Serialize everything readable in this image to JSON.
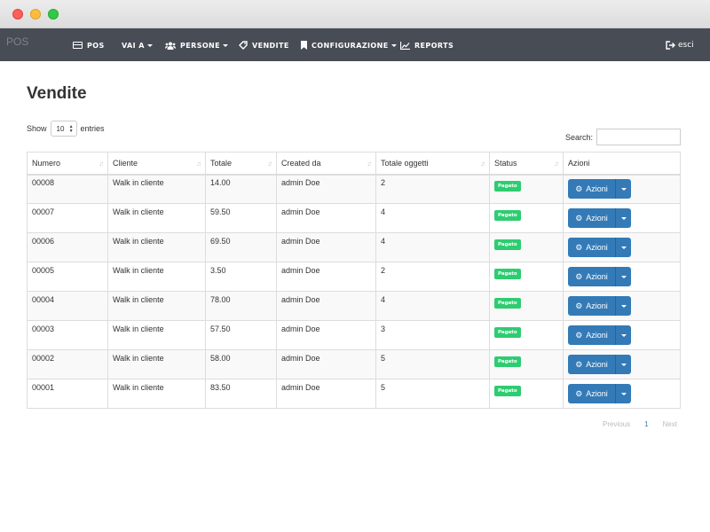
{
  "nav": {
    "brand": "POS",
    "items": [
      {
        "label": "POS",
        "icon": "credit-card-icon"
      },
      {
        "label": "VAI A",
        "icon": "",
        "caret": true
      },
      {
        "label": "PERSONE",
        "icon": "users-icon",
        "caret": true
      },
      {
        "label": "VENDITE",
        "icon": "tag-icon"
      },
      {
        "label": "CONFIGURAZIONE",
        "icon": "bookmark-icon",
        "caret": true
      },
      {
        "label": "REPORTS",
        "icon": "line-chart-icon"
      }
    ],
    "logout": "esci"
  },
  "page": {
    "title": "Vendite"
  },
  "table_controls": {
    "show_label": "Show",
    "entries_value": "10",
    "entries_label": "entries",
    "search_label": "Search:"
  },
  "table": {
    "headers": [
      "Numero",
      "Cliente",
      "Totale",
      "Created da",
      "Totale oggetti",
      "Status",
      "Azioni"
    ],
    "rows": [
      {
        "numero": "00008",
        "cliente": "Walk in cliente",
        "totale": "14.00",
        "created": "admin Doe",
        "oggetti": "2",
        "status": "Pagato",
        "action": "Azioni"
      },
      {
        "numero": "00007",
        "cliente": "Walk in cliente",
        "totale": "59.50",
        "created": "admin Doe",
        "oggetti": "4",
        "status": "Pagato",
        "action": "Azioni"
      },
      {
        "numero": "00006",
        "cliente": "Walk in cliente",
        "totale": "69.50",
        "created": "admin Doe",
        "oggetti": "4",
        "status": "Pagato",
        "action": "Azioni"
      },
      {
        "numero": "00005",
        "cliente": "Walk in cliente",
        "totale": "3.50",
        "created": "admin Doe",
        "oggetti": "2",
        "status": "Pagato",
        "action": "Azioni"
      },
      {
        "numero": "00004",
        "cliente": "Walk in cliente",
        "totale": "78.00",
        "created": "admin Doe",
        "oggetti": "4",
        "status": "Pagato",
        "action": "Azioni"
      },
      {
        "numero": "00003",
        "cliente": "Walk in cliente",
        "totale": "57.50",
        "created": "admin Doe",
        "oggetti": "3",
        "status": "Pagato",
        "action": "Azioni"
      },
      {
        "numero": "00002",
        "cliente": "Walk in cliente",
        "totale": "58.00",
        "created": "admin Doe",
        "oggetti": "5",
        "status": "Pagato",
        "action": "Azioni"
      },
      {
        "numero": "00001",
        "cliente": "Walk in cliente",
        "totale": "83.50",
        "created": "admin Doe",
        "oggetti": "5",
        "status": "Pagato",
        "action": "Azioni"
      }
    ]
  },
  "pagination": {
    "previous": "Previous",
    "current": "1",
    "next": "Next"
  },
  "colors": {
    "navbar": "#474c55",
    "primary_button": "#337ab7",
    "status_paid": "#2ecc71"
  }
}
